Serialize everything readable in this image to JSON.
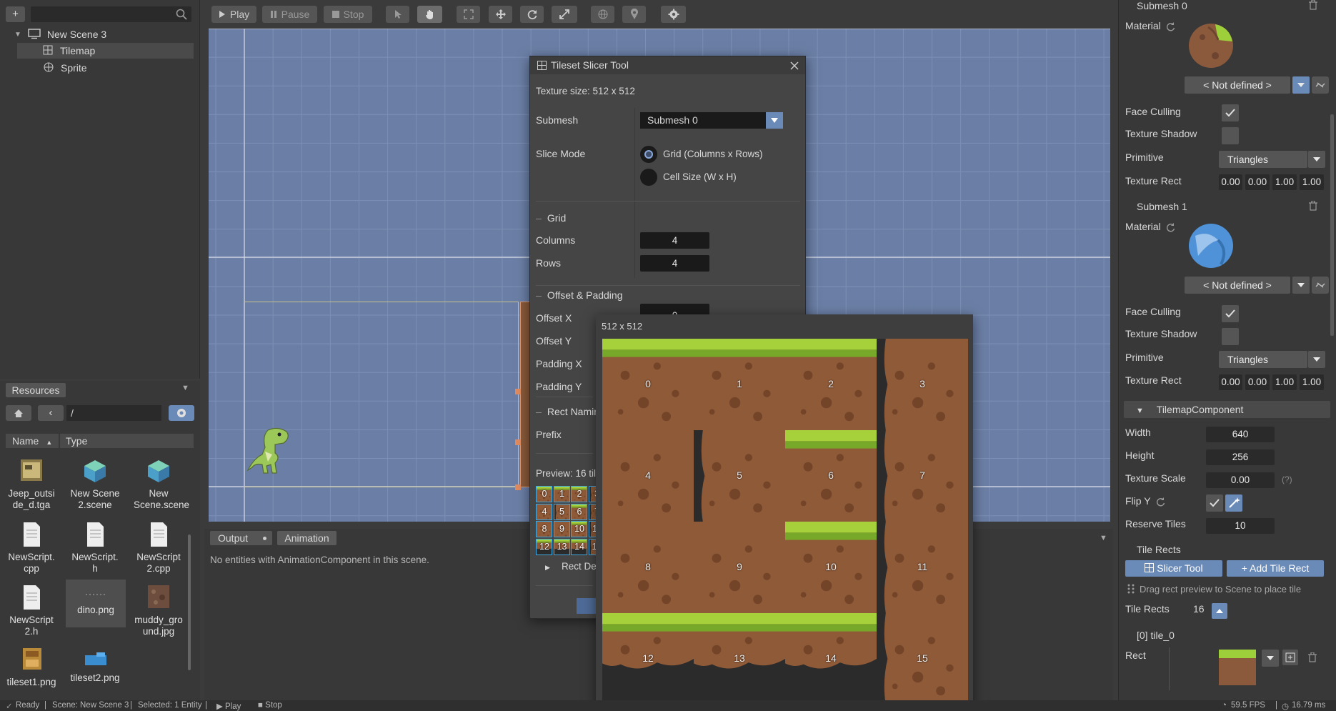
{
  "toolbar": {
    "play": "Play",
    "pause": "Pause",
    "stop": "Stop"
  },
  "hierarchy": {
    "items": [
      {
        "label": "New Scene 3"
      },
      {
        "label": "Tilemap"
      },
      {
        "label": "Sprite"
      }
    ]
  },
  "resources": {
    "tab": "Resources",
    "path": "/",
    "col_name": "Name",
    "col_type": "Type",
    "files": [
      {
        "name": "Jeep_outside_d.tga"
      },
      {
        "name": "New Scene 2.scene"
      },
      {
        "name": "New Scene.scene"
      },
      {
        "name": "NewScript.cpp"
      },
      {
        "name": "NewScript.h"
      },
      {
        "name": "NewScript2.cpp"
      },
      {
        "name": "NewScript2.h"
      },
      {
        "name": "dino.png"
      },
      {
        "name": "muddy_ground.jpg"
      },
      {
        "name": "tileset1.png"
      },
      {
        "name": "tileset2.png"
      }
    ]
  },
  "output": {
    "tab_output": "Output",
    "tab_animation": "Animation",
    "message": "No entities with AnimationComponent in this scene."
  },
  "slicer": {
    "title": "Tileset Slicer Tool",
    "texture_size": "Texture size: 512 x 512",
    "submesh_label": "Submesh",
    "submesh_value": "Submesh 0",
    "slice_mode_label": "Slice Mode",
    "mode_grid": "Grid (Columns x Rows)",
    "mode_cell": "Cell Size (W x H)",
    "grid_header": "Grid",
    "columns_label": "Columns",
    "columns": "4",
    "rows_label": "Rows",
    "rows": "4",
    "offset_header": "Offset & Padding",
    "offset_x_label": "Offset X",
    "offset_x": "0",
    "offset_y_label": "Offset Y",
    "padding_x_label": "Padding X",
    "padding_y_label": "Padding Y",
    "naming_header": "Rect Namin",
    "prefix_label": "Prefix",
    "preview_label": "Preview: 16 til",
    "rect_details": "Rect Det"
  },
  "preview": {
    "size": "512 x 512",
    "tiles": [
      "0",
      "1",
      "2",
      "3",
      "4",
      "5",
      "6",
      "7",
      "8",
      "9",
      "10",
      "11",
      "12",
      "13",
      "14",
      "15"
    ]
  },
  "inspector": {
    "submesh0": "Submesh 0",
    "submesh1": "Submesh 1",
    "material": "Material",
    "not_defined": "< Not defined >",
    "face_culling": "Face Culling",
    "texture_shadow": "Texture Shadow",
    "primitive": "Primitive",
    "primitive_value": "Triangles",
    "texture_rect": "Texture Rect",
    "rect_vals": [
      "0.00",
      "0.00",
      "1.00",
      "1.00"
    ],
    "tilemap_component": "TilemapComponent",
    "width_label": "Width",
    "width": "640",
    "height_label": "Height",
    "height": "256",
    "texture_scale_label": "Texture Scale",
    "texture_scale": "0.00",
    "help": "(?)",
    "flip_y": "Flip Y",
    "reserve_label": "Reserve Tiles",
    "reserve": "10",
    "tile_rects_header": "Tile Rects",
    "slicer_tool_btn": "Slicer Tool",
    "add_rect_btn": "+ Add Tile Rect",
    "drag_hint": "Drag rect preview to Scene to place tile",
    "tile_rects_label": "Tile Rects",
    "tile_rects_count": "16",
    "tile0": "[0] tile_0",
    "rect_label": "Rect"
  },
  "status": {
    "ready": "Ready",
    "scene": "Scene: New Scene 3",
    "selected": "Selected: 1 Entity",
    "play": "Play",
    "stop": "Stop",
    "fps": "59.5 FPS",
    "ms": "16.79 ms"
  },
  "colors": {
    "viewport": "#6b7fa6",
    "accent": "#6a8ab8",
    "grid_line": "#3ea6e0"
  }
}
